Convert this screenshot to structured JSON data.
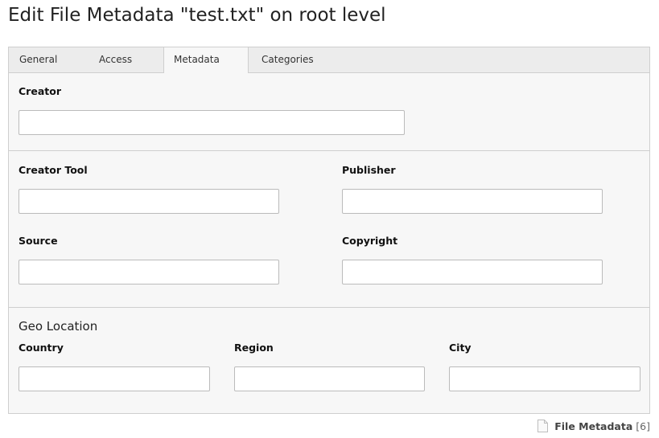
{
  "page": {
    "title": "Edit File Metadata \"test.txt\" on root level"
  },
  "tabs": [
    {
      "label": "General",
      "active": false
    },
    {
      "label": "Access",
      "active": false
    },
    {
      "label": "Metadata",
      "active": true
    },
    {
      "label": "Categories",
      "active": false
    }
  ],
  "fields": {
    "creator": {
      "label": "Creator",
      "value": ""
    },
    "creator_tool": {
      "label": "Creator Tool",
      "value": ""
    },
    "publisher": {
      "label": "Publisher",
      "value": ""
    },
    "source": {
      "label": "Source",
      "value": ""
    },
    "copyright": {
      "label": "Copyright",
      "value": ""
    }
  },
  "geo": {
    "heading": "Geo Location",
    "country": {
      "label": "Country",
      "value": ""
    },
    "region": {
      "label": "Region",
      "value": ""
    },
    "city": {
      "label": "City",
      "value": ""
    }
  },
  "footer": {
    "icon": "document-icon",
    "label": "File Metadata",
    "uid": "[6]"
  }
}
